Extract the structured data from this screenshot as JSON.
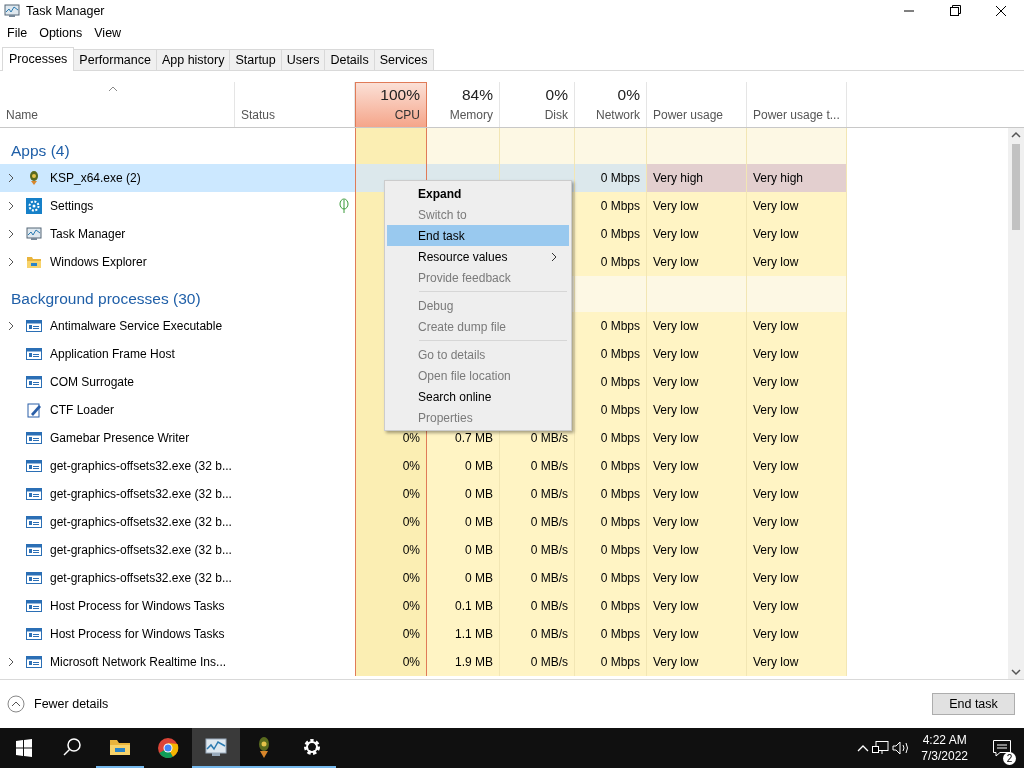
{
  "window": {
    "title": "Task Manager"
  },
  "menu_bar": [
    "File",
    "Options",
    "View"
  ],
  "tabs": [
    {
      "label": "Processes",
      "selected": true
    },
    {
      "label": "Performance",
      "selected": false
    },
    {
      "label": "App history",
      "selected": false
    },
    {
      "label": "Startup",
      "selected": false
    },
    {
      "label": "Users",
      "selected": false
    },
    {
      "label": "Details",
      "selected": false
    },
    {
      "label": "Services",
      "selected": false
    }
  ],
  "columns": [
    {
      "label": "Name",
      "sorted": true,
      "selected": false
    },
    {
      "label": "Status",
      "sorted": false,
      "selected": false
    },
    {
      "percent": "100%",
      "label": "CPU",
      "sorted": false,
      "selected": true
    },
    {
      "percent": "84%",
      "label": "Memory",
      "sorted": false,
      "selected": false
    },
    {
      "percent": "0%",
      "label": "Disk",
      "sorted": false,
      "selected": false
    },
    {
      "percent": "0%",
      "label": "Network",
      "sorted": false,
      "selected": false
    },
    {
      "label": "Power usage",
      "sorted": false,
      "selected": false
    },
    {
      "label": "Power usage t...",
      "sorted": false,
      "selected": false
    }
  ],
  "groups": [
    {
      "title": "Apps (4)",
      "rows": [
        {
          "name": "KSP_x64.exe (2)",
          "kind": "rocket",
          "expandable": true,
          "selected": true,
          "leaf": false,
          "network": "0 Mbps",
          "power": "Very high",
          "power_trend": "Very high",
          "power_high": true
        },
        {
          "name": "Settings",
          "kind": "gear",
          "expandable": true,
          "selected": false,
          "leaf": true,
          "network": "0 Mbps",
          "power": "Very low",
          "power_trend": "Very low",
          "power_high": false
        },
        {
          "name": "Task Manager",
          "kind": "monitor",
          "expandable": true,
          "selected": false,
          "leaf": false,
          "network": "0 Mbps",
          "power": "Very low",
          "power_trend": "Very low",
          "power_high": false
        },
        {
          "name": "Windows Explorer",
          "kind": "folder",
          "expandable": true,
          "selected": false,
          "leaf": false,
          "network": "0 Mbps",
          "power": "Very low",
          "power_trend": "Very low",
          "power_high": false
        }
      ]
    },
    {
      "title": "Background processes (30)",
      "rows": [
        {
          "name": "Antimalware Service Executable",
          "kind": "window",
          "expandable": true,
          "selected": false,
          "leaf": false,
          "network": "0 Mbps",
          "power": "Very low",
          "power_trend": "Very low",
          "power_high": false
        },
        {
          "name": "Application Frame Host",
          "kind": "window",
          "expandable": false,
          "selected": false,
          "leaf": false,
          "network": "0 Mbps",
          "power": "Very low",
          "power_trend": "Very low",
          "power_high": false
        },
        {
          "name": "COM Surrogate",
          "kind": "window",
          "expandable": false,
          "selected": false,
          "leaf": false,
          "network": "0 Mbps",
          "power": "Very low",
          "power_trend": "Very low",
          "power_high": false
        },
        {
          "name": "CTF Loader",
          "kind": "pencil",
          "expandable": false,
          "selected": false,
          "leaf": false,
          "network": "0 Mbps",
          "power": "Very low",
          "power_trend": "Very low",
          "power_high": false
        },
        {
          "name": "Gamebar Presence Writer",
          "kind": "window",
          "expandable": false,
          "selected": false,
          "leaf": false,
          "cpu": "0%",
          "memory": "0.7 MB",
          "disk": "0 MB/s",
          "network": "0 Mbps",
          "power": "Very low",
          "power_trend": "Very low",
          "power_high": false
        },
        {
          "name": "get-graphics-offsets32.exe (32 b...",
          "kind": "window",
          "expandable": false,
          "selected": false,
          "leaf": false,
          "cpu": "0%",
          "memory": "0 MB",
          "disk": "0 MB/s",
          "network": "0 Mbps",
          "power": "Very low",
          "power_trend": "Very low",
          "power_high": false
        },
        {
          "name": "get-graphics-offsets32.exe (32 b...",
          "kind": "window",
          "expandable": false,
          "selected": false,
          "leaf": false,
          "cpu": "0%",
          "memory": "0 MB",
          "disk": "0 MB/s",
          "network": "0 Mbps",
          "power": "Very low",
          "power_trend": "Very low",
          "power_high": false
        },
        {
          "name": "get-graphics-offsets32.exe (32 b...",
          "kind": "window",
          "expandable": false,
          "selected": false,
          "leaf": false,
          "cpu": "0%",
          "memory": "0 MB",
          "disk": "0 MB/s",
          "network": "0 Mbps",
          "power": "Very low",
          "power_trend": "Very low",
          "power_high": false
        },
        {
          "name": "get-graphics-offsets32.exe (32 b...",
          "kind": "window",
          "expandable": false,
          "selected": false,
          "leaf": false,
          "cpu": "0%",
          "memory": "0 MB",
          "disk": "0 MB/s",
          "network": "0 Mbps",
          "power": "Very low",
          "power_trend": "Very low",
          "power_high": false
        },
        {
          "name": "get-graphics-offsets32.exe (32 b...",
          "kind": "window",
          "expandable": false,
          "selected": false,
          "leaf": false,
          "cpu": "0%",
          "memory": "0 MB",
          "disk": "0 MB/s",
          "network": "0 Mbps",
          "power": "Very low",
          "power_trend": "Very low",
          "power_high": false
        },
        {
          "name": "Host Process for Windows Tasks",
          "kind": "window",
          "expandable": false,
          "selected": false,
          "leaf": false,
          "cpu": "0%",
          "memory": "0.1 MB",
          "disk": "0 MB/s",
          "network": "0 Mbps",
          "power": "Very low",
          "power_trend": "Very low",
          "power_high": false
        },
        {
          "name": "Host Process for Windows Tasks",
          "kind": "window",
          "expandable": false,
          "selected": false,
          "leaf": false,
          "cpu": "0%",
          "memory": "1.1 MB",
          "disk": "0 MB/s",
          "network": "0 Mbps",
          "power": "Very low",
          "power_trend": "Very low",
          "power_high": false
        },
        {
          "name": "Microsoft Network Realtime Ins...",
          "kind": "window",
          "expandable": true,
          "selected": false,
          "leaf": false,
          "cpu": "0%",
          "memory": "1.9 MB",
          "disk": "0 MB/s",
          "network": "0 Mbps",
          "power": "Very low",
          "power_trend": "Very low",
          "power_high": false
        }
      ]
    }
  ],
  "context_menu": [
    {
      "kind": "item",
      "label": "Expand",
      "bold": true,
      "disabled": false,
      "selected": false
    },
    {
      "kind": "item",
      "label": "Switch to",
      "bold": false,
      "disabled": true,
      "selected": false
    },
    {
      "kind": "item",
      "label": "End task",
      "bold": false,
      "disabled": false,
      "selected": true
    },
    {
      "kind": "submenu",
      "label": "Resource values",
      "bold": false,
      "disabled": false,
      "selected": false
    },
    {
      "kind": "item",
      "label": "Provide feedback",
      "bold": false,
      "disabled": true,
      "selected": false
    },
    {
      "kind": "separator"
    },
    {
      "kind": "item",
      "label": "Debug",
      "bold": false,
      "disabled": true,
      "selected": false
    },
    {
      "kind": "item",
      "label": "Create dump file",
      "bold": false,
      "disabled": true,
      "selected": false
    },
    {
      "kind": "separator"
    },
    {
      "kind": "item",
      "label": "Go to details",
      "bold": false,
      "disabled": true,
      "selected": false
    },
    {
      "kind": "item",
      "label": "Open file location",
      "bold": false,
      "disabled": true,
      "selected": false
    },
    {
      "kind": "item",
      "label": "Search online",
      "bold": false,
      "disabled": false,
      "selected": false
    },
    {
      "kind": "item",
      "label": "Properties",
      "bold": false,
      "disabled": true,
      "selected": false
    }
  ],
  "footer": {
    "details_link": "Fewer details",
    "button": "End task"
  },
  "taskbar": {
    "apps": [
      {
        "kind": "folder",
        "running": true,
        "selected": false
      },
      {
        "kind": "browser",
        "running": false,
        "selected": false
      },
      {
        "kind": "monitor",
        "running": true,
        "selected": true
      },
      {
        "kind": "rocket",
        "running": true,
        "selected": false
      },
      {
        "kind": "gear",
        "running": true,
        "selected": false
      }
    ],
    "time": "4:22 AM",
    "date": "7/3/2022",
    "notifications": "2"
  }
}
